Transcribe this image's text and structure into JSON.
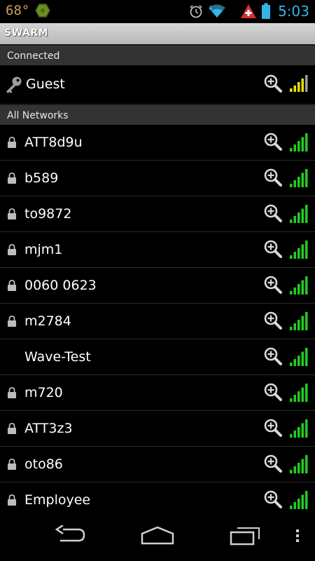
{
  "status_bar": {
    "temperature": "68°",
    "time": "5:03",
    "icons": [
      "temperature-indicator",
      "hexagon-app-icon",
      "alarm-icon",
      "wifi-icon",
      "swiss-alert-icon",
      "battery-icon"
    ]
  },
  "app": {
    "title": "SWARM"
  },
  "sections": {
    "connected": {
      "header": "Connected",
      "network": {
        "name": "Guest",
        "secured_icon": "key-icon",
        "signal_color": "#e8e000"
      }
    },
    "all_networks": {
      "header": "All Networks",
      "networks": [
        {
          "name": "ATT8d9u",
          "locked": true
        },
        {
          "name": "b589",
          "locked": true
        },
        {
          "name": "to9872",
          "locked": true
        },
        {
          "name": "mjm1",
          "locked": true
        },
        {
          "name": "0060 0623",
          "locked": true
        },
        {
          "name": "m2784",
          "locked": true
        },
        {
          "name": "Wave-Test",
          "locked": false
        },
        {
          "name": "m720",
          "locked": true
        },
        {
          "name": "ATT3z3",
          "locked": true
        },
        {
          "name": "oto86",
          "locked": true
        },
        {
          "name": "Employee",
          "locked": true
        }
      ],
      "signal_color": "#22cc22"
    }
  },
  "nav_bar": {
    "buttons": [
      "back-icon",
      "home-icon",
      "recent-apps-icon",
      "overflow-menu-icon"
    ]
  },
  "colors": {
    "background": "#000000",
    "section_header": "#333333",
    "clock": "#33b5e5",
    "signal_strong": "#22cc22",
    "signal_connected": "#e8e000"
  }
}
